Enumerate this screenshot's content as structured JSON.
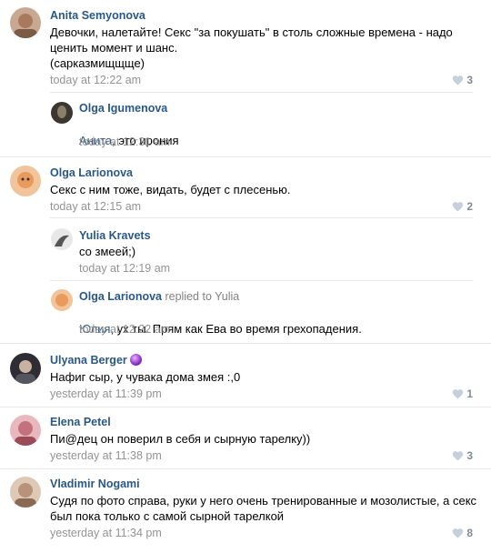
{
  "comments": [
    {
      "author": "Anita Semyonova",
      "text": "Девочки, налетайте! Секс \"за покушать\" в столь сложные времена - надо ценить момент и шанс.\n(сарказмищщще)",
      "time": "today at 12:22 am",
      "likes": "3",
      "avatar_color": "#a77a5e",
      "replies": [
        {
          "author": "Olga Igumenova",
          "mention": "Анита",
          "text": ", это ирония",
          "time": "today at 12:31 am",
          "avatar_color": "#2f2a25"
        }
      ]
    },
    {
      "author": "Olga Larionova",
      "text": "Секс с ним тоже, видать, будет с плесенью.",
      "time": "today at 12:15 am",
      "likes": "2",
      "avatar_color": "#e99a5d",
      "replies": [
        {
          "author": "Yulia Kravets",
          "text": "со змеей;)",
          "time": "today at 12:19 am",
          "avatar_color": "#8d8d8d"
        },
        {
          "author": "Olga Larionova",
          "replied_to": "replied to Yulia",
          "mention": "Юлия",
          "text": ", ух ты. Прям как Ева во время грехопадения.",
          "time": "today at 12:22 am",
          "avatar_color": "#e99a5d"
        }
      ]
    },
    {
      "author": "Ulyana Berger",
      "text": "Нафиг сыр, у чувака дома змея :,0",
      "time": "yesterday at 11:39 pm",
      "likes": "1",
      "avatar_color": "#4a4a52"
    },
    {
      "author": "Elena Petel",
      "text": "Пи@дец он поверил в себя и сырную тарелку))",
      "time": "yesterday at 11:38 pm",
      "likes": "3",
      "avatar_color": "#c4717e"
    },
    {
      "author": "Vladimir Nogami",
      "text": "Судя по фото справа, руки у него очень тренированные и мозолистые, а секс был пока только с самой сырной тарелкой",
      "time": "yesterday at 11:34 pm",
      "likes": "8",
      "avatar_color": "#b8937a"
    }
  ]
}
